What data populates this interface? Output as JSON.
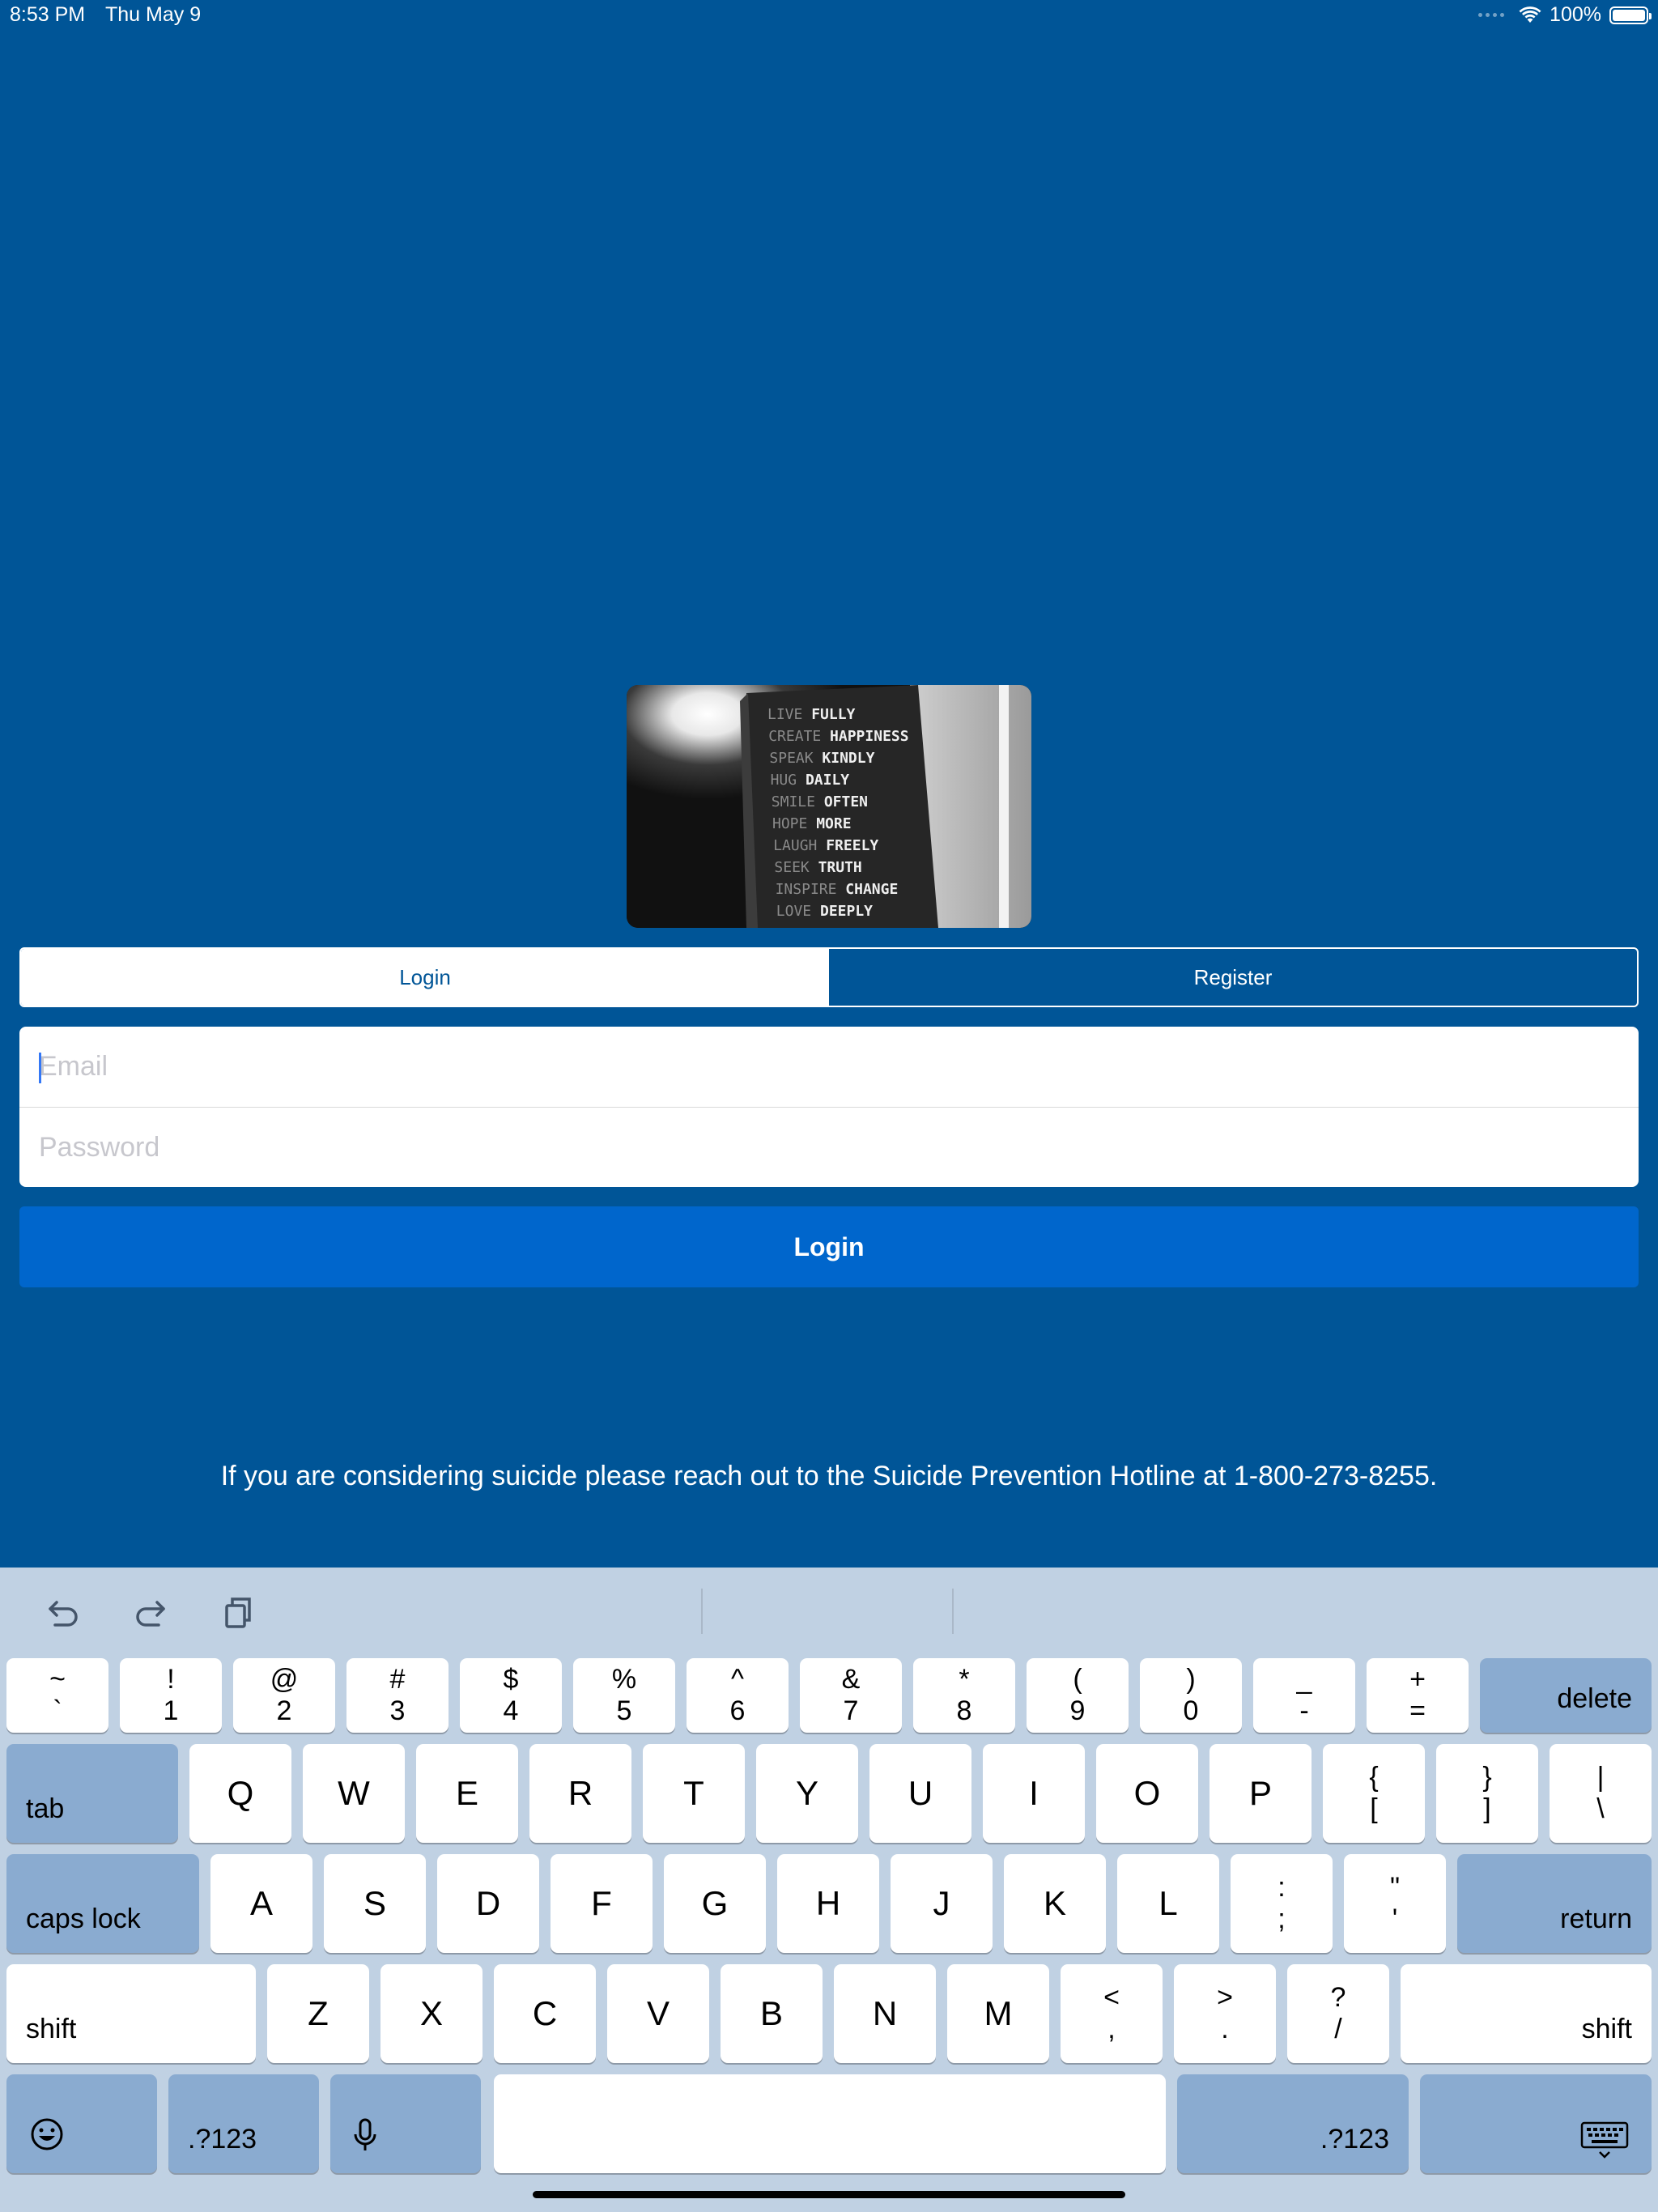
{
  "status_bar": {
    "time": "8:53 PM",
    "date": "Thu May 9",
    "battery": "100%",
    "battery_level": 1.0
  },
  "hero_image": {
    "lines": [
      {
        "a": "LIVE",
        "b": "FULLY"
      },
      {
        "a": "CREATE",
        "b": "HAPPINESS"
      },
      {
        "a": "SPEAK",
        "b": "KINDLY"
      },
      {
        "a": "HUG",
        "b": "DAILY"
      },
      {
        "a": "SMILE",
        "b": "OFTEN"
      },
      {
        "a": "HOPE",
        "b": "MORE"
      },
      {
        "a": "LAUGH",
        "b": "FREELY"
      },
      {
        "a": "SEEK",
        "b": "TRUTH"
      },
      {
        "a": "INSPIRE",
        "b": "CHANGE"
      },
      {
        "a": "LOVE",
        "b": "DEEPLY"
      }
    ]
  },
  "tabs": {
    "login": "Login",
    "register": "Register",
    "selected": "login"
  },
  "form": {
    "email_placeholder": "Email",
    "email_value": "",
    "password_placeholder": "Password",
    "password_value": "",
    "submit_label": "Login"
  },
  "hotline_text": "If you are considering suicide please reach out to the Suicide Prevention Hotline at 1-800-273-8255.",
  "keyboard": {
    "row1": [
      {
        "top": "~",
        "bot": "`"
      },
      {
        "top": "!",
        "bot": "1"
      },
      {
        "top": "@",
        "bot": "2"
      },
      {
        "top": "#",
        "bot": "3"
      },
      {
        "top": "$",
        "bot": "4"
      },
      {
        "top": "%",
        "bot": "5"
      },
      {
        "top": "^",
        "bot": "6"
      },
      {
        "top": "&",
        "bot": "7"
      },
      {
        "top": "*",
        "bot": "8"
      },
      {
        "top": "(",
        "bot": "9"
      },
      {
        "top": ")",
        "bot": "0"
      },
      {
        "top": "_",
        "bot": "-"
      },
      {
        "top": "+",
        "bot": "="
      }
    ],
    "delete": "delete",
    "tab": "tab",
    "row2": [
      "Q",
      "W",
      "E",
      "R",
      "T",
      "Y",
      "U",
      "I",
      "O",
      "P"
    ],
    "row2_sym": [
      {
        "top": "{",
        "bot": "["
      },
      {
        "top": "}",
        "bot": "]"
      },
      {
        "top": "|",
        "bot": "\\"
      }
    ],
    "caps_lock": "caps lock",
    "row3": [
      "A",
      "S",
      "D",
      "F",
      "G",
      "H",
      "J",
      "K",
      "L"
    ],
    "row3_sym": [
      {
        "top": ":",
        "bot": ";"
      },
      {
        "top": "\"",
        "bot": "'"
      }
    ],
    "return": "return",
    "shift": "shift",
    "row4": [
      "Z",
      "X",
      "C",
      "V",
      "B",
      "N",
      "M"
    ],
    "row4_sym": [
      {
        "top": "<",
        "bot": ","
      },
      {
        "top": ">",
        "bot": "."
      },
      {
        "top": "?",
        "bot": "/"
      }
    ],
    "numbers_label": ".?123"
  },
  "colors": {
    "background": "#005597",
    "button": "#0066cc",
    "keyboard_bg": "#c0d1e3",
    "function_key": "#8aabd0"
  }
}
